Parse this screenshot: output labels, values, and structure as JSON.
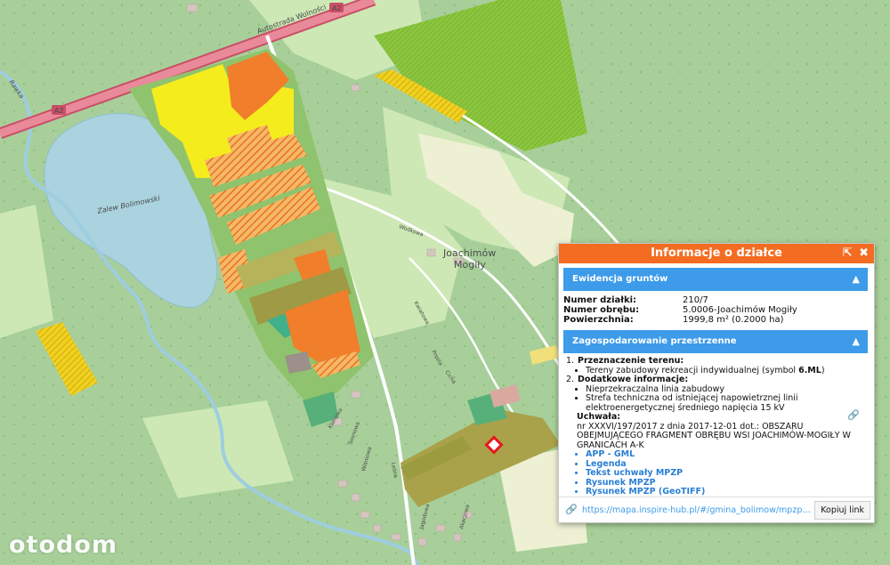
{
  "map": {
    "road_label_a2_left": "A2",
    "road_label_a2_right": "A2",
    "road_label_autostrada": "Autostrada Wolności",
    "lake_label": "Zalew Bolimowski",
    "village_label_line1": "Joachimów",
    "village_label_line2": "Mogiły",
    "street_labels": [
      "Wodkowa",
      "Leśna",
      "Kwiatowa",
      "Klonowa",
      "Jagodowa",
      "Akacjowa",
      "Prosta",
      "Sosnowa",
      "Wiśniowa",
      "Cicha"
    ],
    "river_label": "Rawka",
    "colors": {
      "forest": "#a8cf9a",
      "meadow": "#cde8b5",
      "field": "#eef0d4",
      "water": "#aad3df",
      "zone_yellow": "#f5ec1e",
      "zone_orange": "#f07e2a",
      "zone_green": "#8fc46a",
      "zone_olive": "#9a9a3c",
      "highway": "#e26b80"
    }
  },
  "watermark": "otodom",
  "panel": {
    "title": "Informacje o działce",
    "ctrl_collapse": "⇱",
    "ctrl_close": "✖",
    "section1": {
      "title": "Ewidencja gruntów",
      "rows": [
        {
          "label": "Numer działki:",
          "value": "210/7"
        },
        {
          "label": "Numer obrębu:",
          "value": "5.0006-Joachimów Mogiły"
        },
        {
          "label": "Powierzchnia:",
          "value": "1999,8 m² (0.2000 ha)"
        }
      ]
    },
    "section2": {
      "title": "Zagospodarowanie przestrzenne",
      "item1_num": "1.",
      "item1_head": "Przeznaczenie terenu:",
      "item1_bullet_text": "Tereny zabudowy rekreacji indywidualnej (symbol ",
      "item1_bullet_symbol": "6.ML",
      "item1_bullet_end": ")",
      "item2_num": "2.",
      "item2_head": "Dodatkowe informacje:",
      "item2_bullets": [
        "Nieprzekraczalna linia zabudowy",
        "Strefa techniczna od istniejącej napowietrznej linii elektroenergetycznej średniego napięcia 15 kV"
      ],
      "uchwala_title": "Uchwała:",
      "uchwala_text": "nr XXXVI/197/2017 z dnia 2017-12-01 dot.: OBSZARU OBEJMUJĄCEGO FRAGMENT OBRĘBU WSI JOACHIMÓW-MOGIŁY W GRANICACH A-K",
      "links": [
        "APP - GML",
        "Legenda",
        "Tekst uchwały MPZP",
        "Rysunek MPZP",
        "Rysunek MPZP (GeoTIFF)"
      ]
    },
    "footer": {
      "url": "https://mapa.inspire-hub.pl/#/gmina_bolimow/mpzp/działki",
      "copy_label": "Kopiuj link"
    }
  }
}
